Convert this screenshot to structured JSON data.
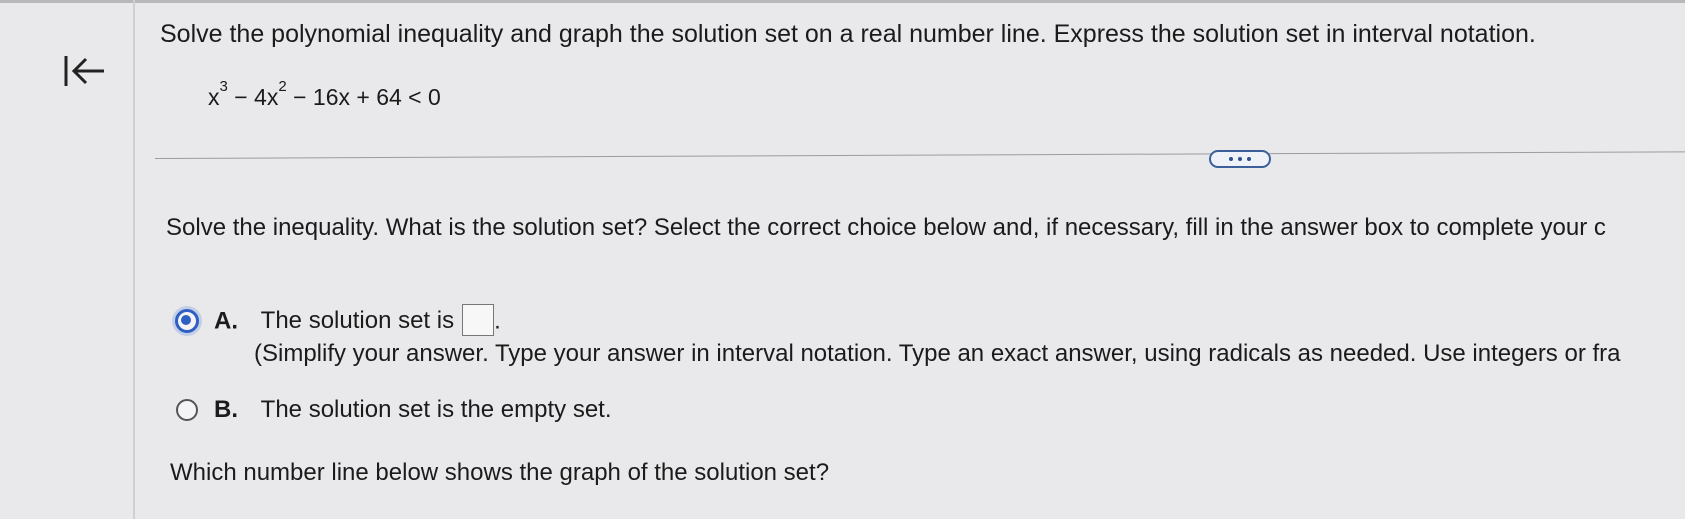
{
  "header": {
    "question": "Solve the polynomial inequality and graph the solution set on a real number line. Express the solution set in interval notation.",
    "equation": {
      "base1": "x",
      "exp1": "3",
      "middle1": " − 4x",
      "exp2": "2",
      "rest": " − 16x + 64 < 0"
    },
    "back_icon": "arrow-to-left-bar-icon"
  },
  "more_button": {
    "icon": "ellipsis-icon"
  },
  "part1": {
    "prompt": "Solve the inequality. What is the solution set? Select the correct choice below and, if necessary, fill in the answer box to complete your c",
    "choices": [
      {
        "letter": "A.",
        "text": "The solution set is",
        "after_box": ".",
        "answer_value": "",
        "selected": true,
        "hint": "(Simplify your answer. Type your answer in interval notation. Type an exact answer, using radicals as needed. Use integers or fra"
      },
      {
        "letter": "B.",
        "text": "The solution set is the empty set.",
        "selected": false
      }
    ]
  },
  "part2": {
    "question": "Which number line below shows the graph of the solution set?"
  },
  "colors": {
    "background": "#e9e9eb",
    "accent": "#2f5fc4",
    "text": "#1b1b1b"
  }
}
